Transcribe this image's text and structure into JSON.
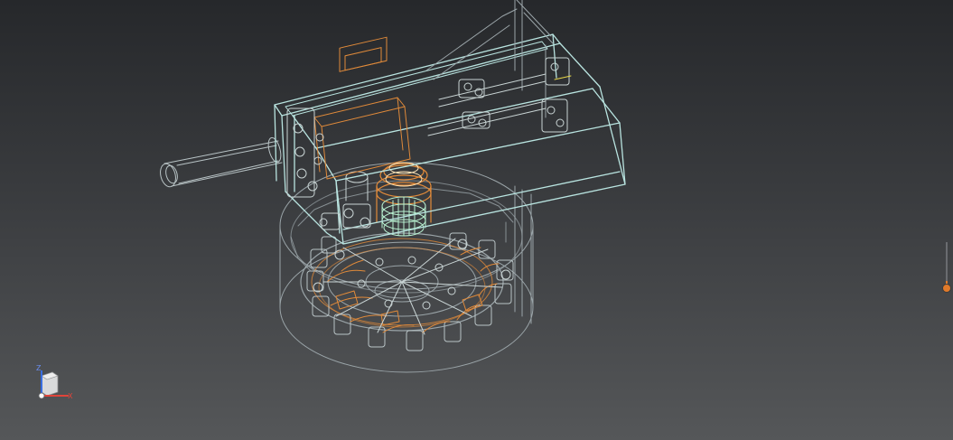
{
  "viewport": {
    "render_mode": "wireframe",
    "colors": {
      "background_top": "#26282b",
      "background_bottom": "#555759",
      "edge_primary": "#b9e4e0",
      "edge_secondary": "#9aa4a8",
      "edge_highlight": "#e08a3a",
      "edge_inner": "#c9d4d4"
    }
  },
  "triad": {
    "x_label": "X",
    "z_label": "Z",
    "x_color": "#e0443a",
    "z_color": "#3a6ee0",
    "icon": "view-cube-icon"
  },
  "view_slider": {
    "level": 0.15,
    "accent_color": "#e07a2a",
    "icon": "view-slider-icon"
  }
}
